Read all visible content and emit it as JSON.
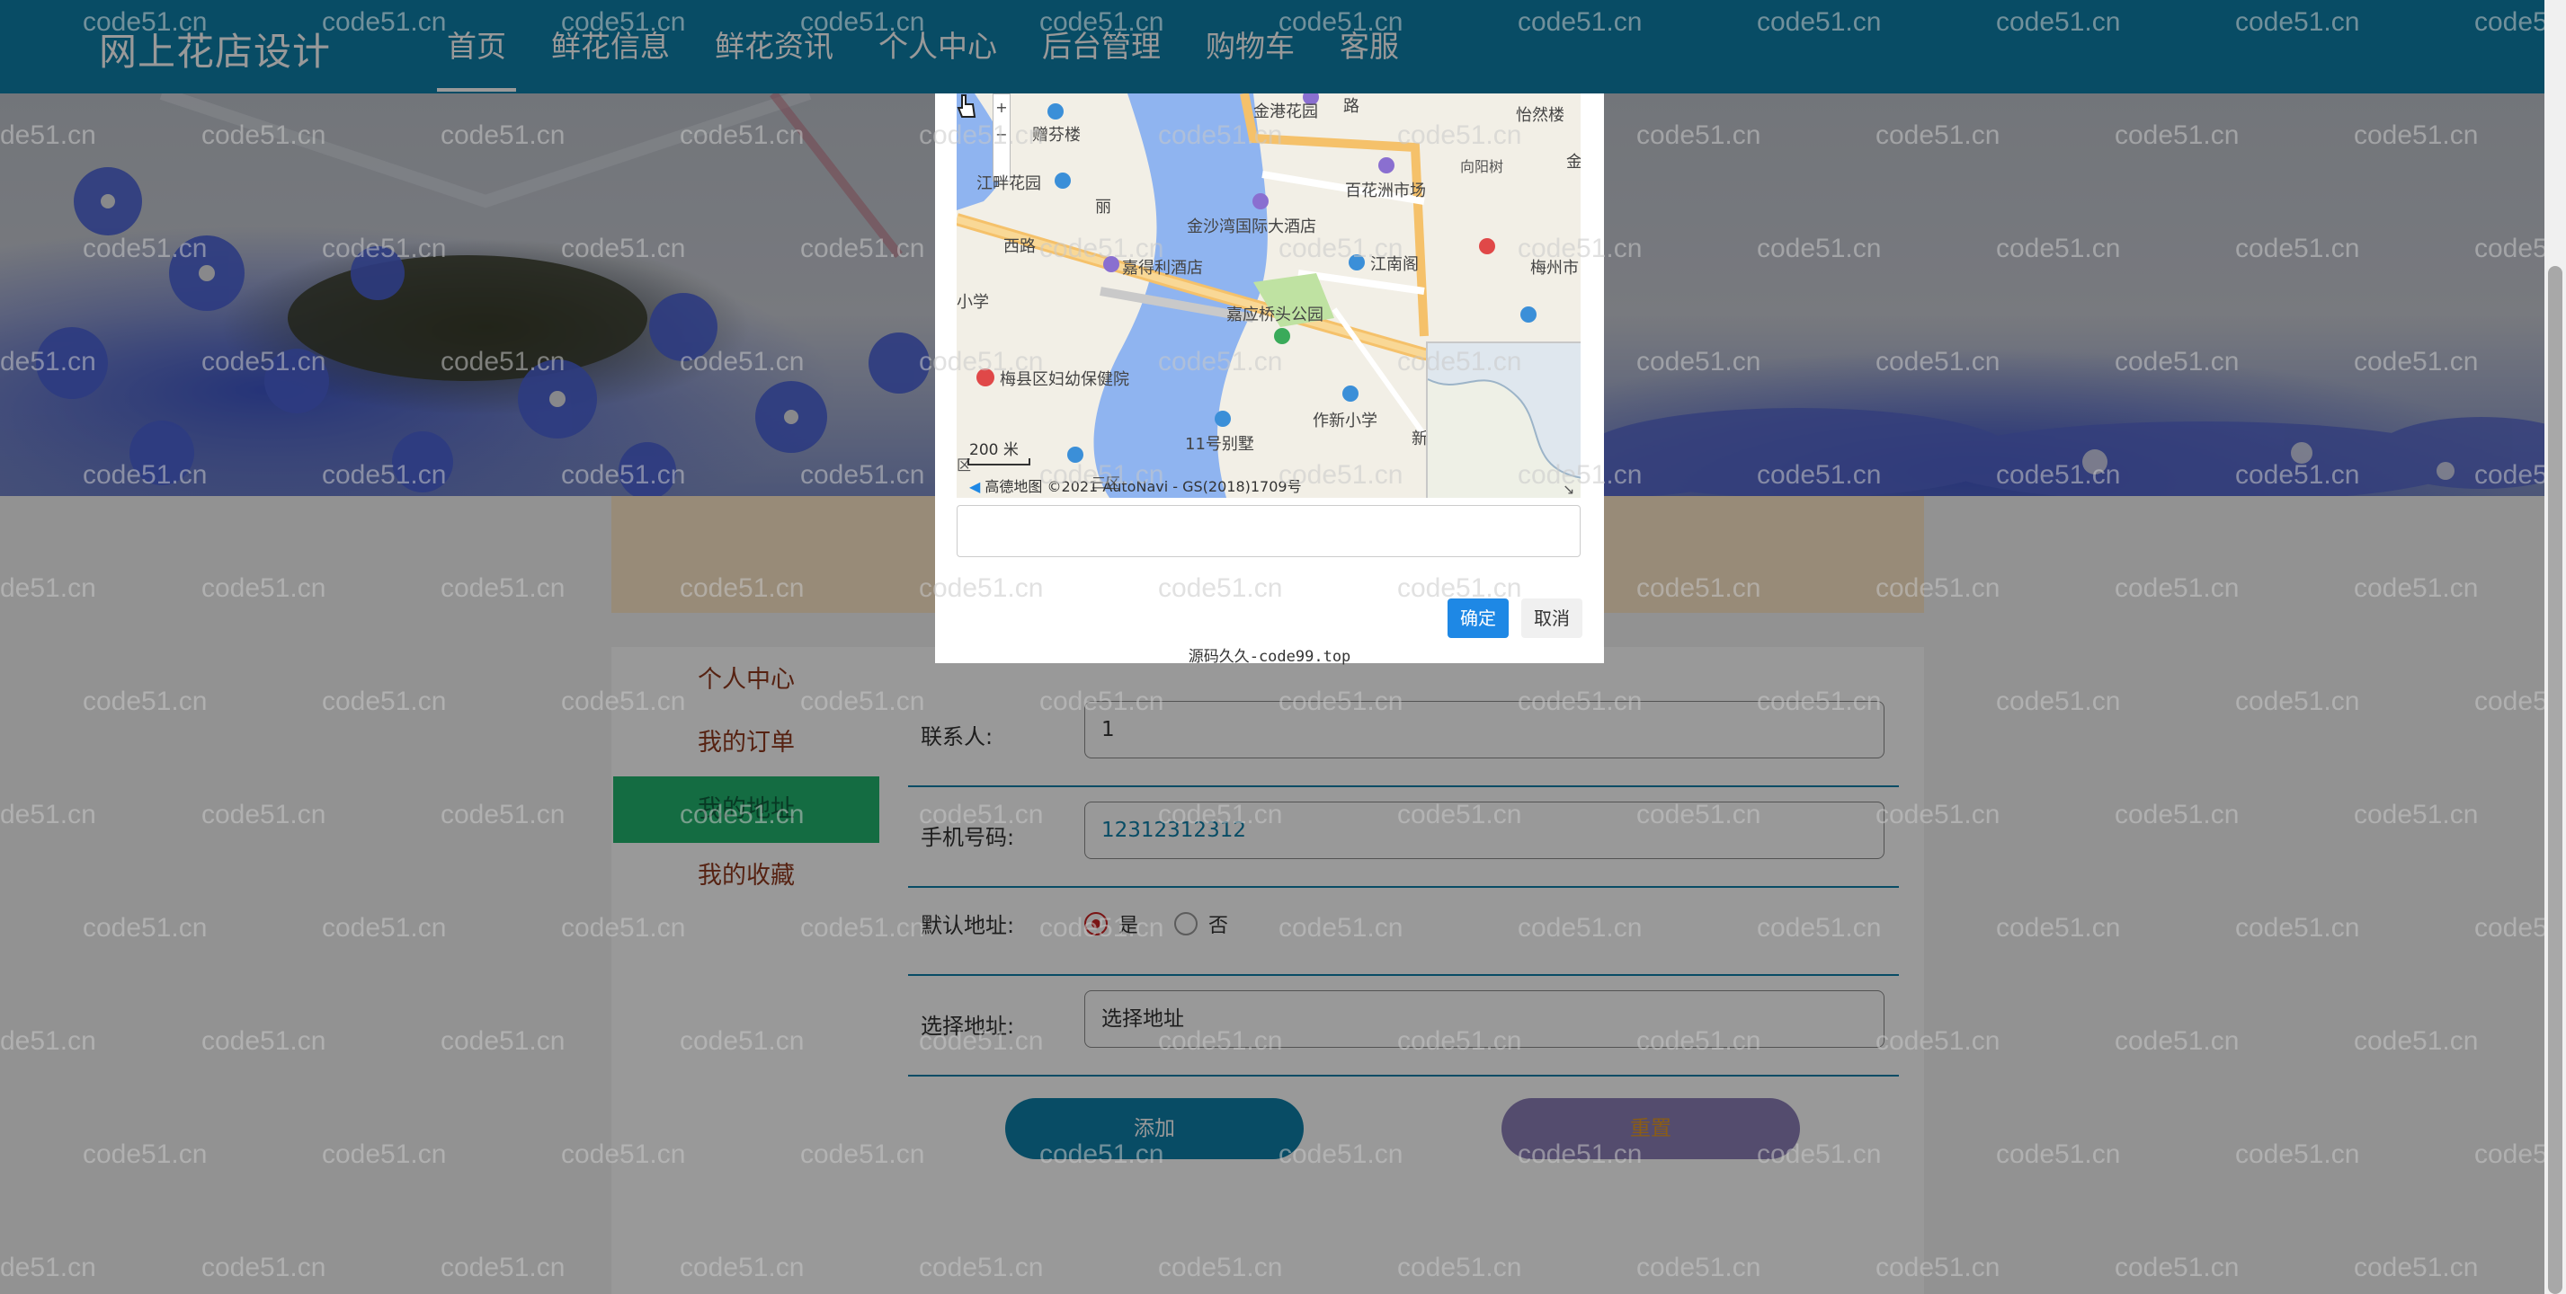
{
  "header": {
    "brand": "网上花店设计",
    "nav": [
      "首页",
      "鲜花信息",
      "鲜花资讯",
      "个人中心",
      "后台管理",
      "购物车",
      "客服"
    ],
    "active_index": 0
  },
  "sidebar": {
    "title": "个人中心",
    "items": [
      "我的订单",
      "我的地址",
      "我的收藏"
    ],
    "active": "我的地址"
  },
  "form": {
    "contact": {
      "label": "联系人:",
      "value": "1"
    },
    "phone": {
      "label": "手机号码:",
      "value": "12312312312"
    },
    "default_address": {
      "label": "默认地址:",
      "options": [
        "是",
        "否"
      ],
      "selected": "是"
    },
    "address": {
      "label": "选择地址:",
      "value": "选择地址"
    },
    "add_label": "添加",
    "reset_label": "重置"
  },
  "modal": {
    "map_labels": {
      "jingang_garden": "金港花园",
      "road": "路",
      "yiran": "怡然楼",
      "zengfen": "赠芬楼",
      "xiangyang": "向阳树",
      "jin": "金",
      "jiangpan": "江畔花园",
      "li": "丽",
      "baihuazhou": "百花洲市场",
      "jinshawan": "金沙湾国际大酒店",
      "west_road": "西路",
      "jiade": "嘉得利酒店",
      "jiangnan_ge": "江南阁",
      "meizhou": "梅州市",
      "primary": "小学",
      "jiaying_park": "嘉应桥头公园",
      "meixian_hospital": "梅县区妇幼保健院",
      "zuoxin": "作新小学",
      "villa": "11号别墅",
      "xin": "新",
      "district": "区",
      "san": "三区"
    },
    "scale": "200 米",
    "copyright": "©2021 AutoNavi - GS(2018)1709号",
    "logo_text": "高德地图",
    "zoom_in": "+",
    "zoom_out": "−",
    "search_value": "",
    "confirm_label": "确定",
    "cancel_label": "取消",
    "footer": "源码久久-code99.top"
  },
  "watermark": "code51.cn",
  "watermark_partial_left": "de51.cn",
  "colors": {
    "nav_bg": "#0e7fa8",
    "sidebar_active": "#22b46e",
    "confirm": "#1e88e5"
  }
}
